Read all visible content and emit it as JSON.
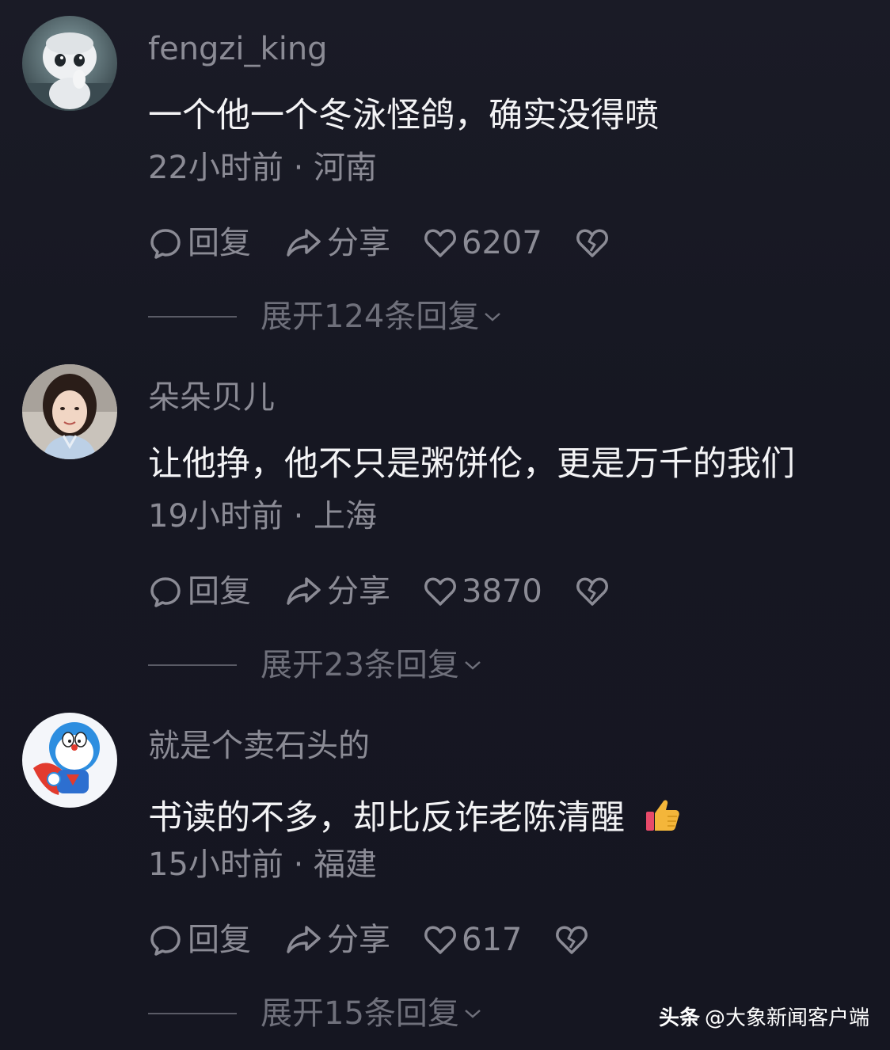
{
  "comments": [
    {
      "username": "fengzi_king",
      "avatar_icon": "white-robot-avatar",
      "content": "一个他一个冬泳怪鸽，确实没得喷",
      "meta": "22小时前 · 河南",
      "reply_label": "回复",
      "share_label": "分享",
      "likes": "6207",
      "expand_label": "展开124条回复"
    },
    {
      "username": "朵朵贝儿",
      "avatar_icon": "girl-photo-avatar",
      "content": "让他挣，他不只是粥饼伦，更是万千的我们",
      "meta": "19小时前 · 上海",
      "reply_label": "回复",
      "share_label": "分享",
      "likes": "3870",
      "expand_label": "展开23条回复"
    },
    {
      "username": "就是个卖石头的",
      "avatar_icon": "superhero-cat-avatar",
      "content": "书读的不多，却比反诈老陈清醒",
      "content_emoji": "thumbs-up-icon",
      "meta": "15小时前 · 福建",
      "reply_label": "回复",
      "share_label": "分享",
      "likes": "617",
      "expand_label": "展开15条回复"
    }
  ],
  "watermark": {
    "brand": "头条",
    "source": "@大象新闻客户端"
  },
  "colors": {
    "background": "#161722",
    "primary_text": "#f3f3f5",
    "secondary_text": "#8b8b95",
    "thumbs_up": "#f4b63a"
  }
}
